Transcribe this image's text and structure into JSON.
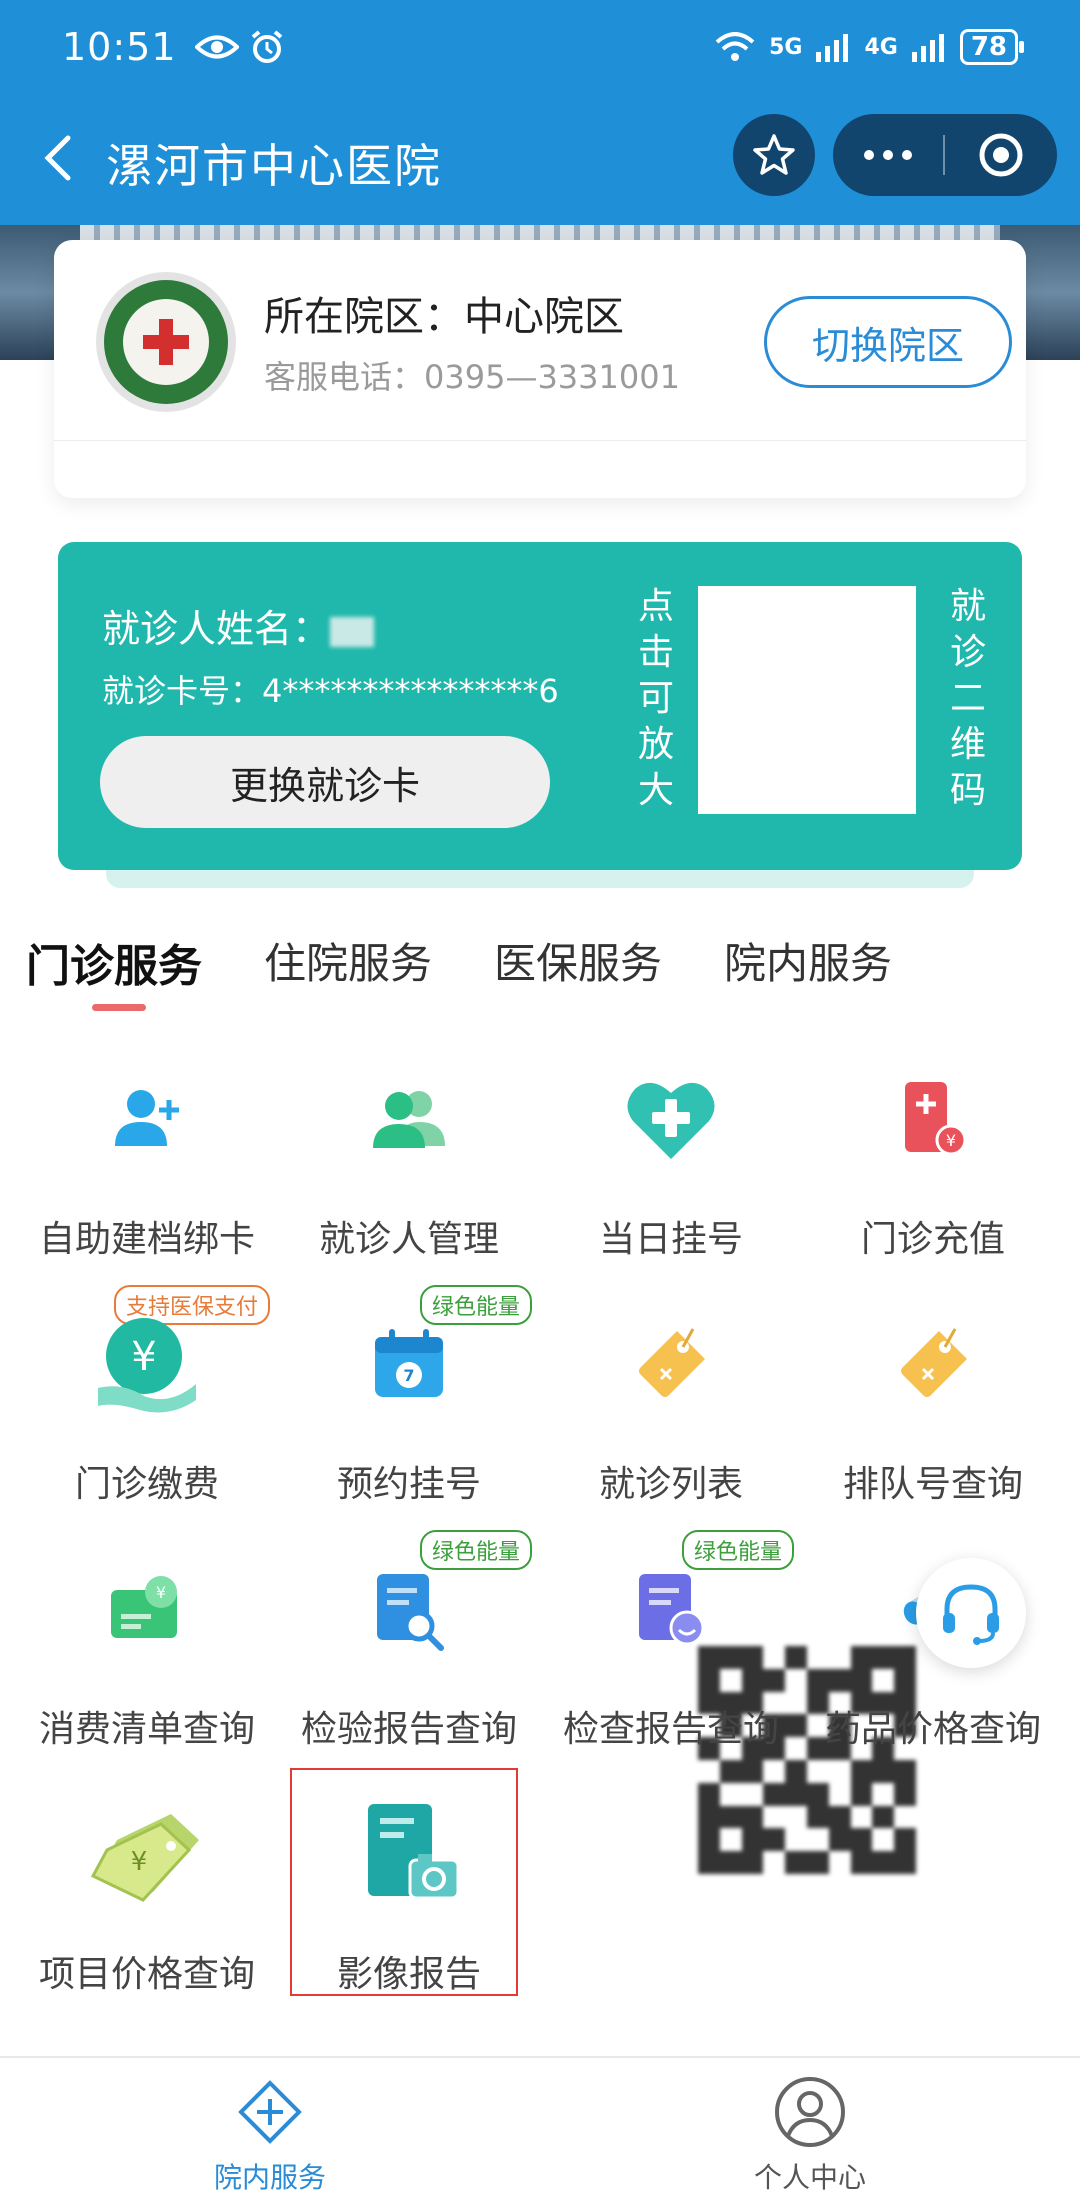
{
  "status_bar": {
    "time": "10:51",
    "net1": "5G",
    "net2": "4G",
    "battery": "78"
  },
  "header": {
    "title": "漯河市中心医院"
  },
  "hospital": {
    "campus": "所在院区：中心院区",
    "phone": "客服电话：0395—3331001",
    "switch_label": "切换院区"
  },
  "patient": {
    "name_label": "就诊人姓名：",
    "card_no": "就诊卡号：4****************6",
    "change_card_label": "更换就诊卡",
    "tap_hint": [
      "点",
      "击",
      "可",
      "放",
      "大"
    ],
    "qr_caption": [
      "就",
      "诊",
      "二",
      "维",
      "码"
    ]
  },
  "tabs": [
    {
      "label": "门诊服务"
    },
    {
      "label": "住院服务"
    },
    {
      "label": "医保服务"
    },
    {
      "label": "院内服务"
    }
  ],
  "services": [
    {
      "label": "自助建档绑卡",
      "icon": "add-user-icon"
    },
    {
      "label": "就诊人管理",
      "icon": "users-icon"
    },
    {
      "label": "当日挂号",
      "icon": "heart-plus-icon"
    },
    {
      "label": "门诊充值",
      "icon": "recharge-icon"
    },
    {
      "label": "门诊缴费",
      "icon": "yuan-hand-icon",
      "badge": "支持医保支付"
    },
    {
      "label": "预约挂号",
      "icon": "calendar-icon",
      "badge": "绿色能量"
    },
    {
      "label": "就诊列表",
      "icon": "tag-icon"
    },
    {
      "label": "排队号查询",
      "icon": "tag-icon"
    },
    {
      "label": "消费清单查询",
      "icon": "bill-icon"
    },
    {
      "label": "检验报告查询",
      "icon": "report-search-icon",
      "badge": "绿色能量"
    },
    {
      "label": "检查报告查询",
      "icon": "report-smile-icon",
      "badge": "绿色能量"
    },
    {
      "label": "药品价格查询",
      "icon": "pill-icon"
    },
    {
      "label": "项目价格查询",
      "icon": "price-tag-icon"
    },
    {
      "label": "影像报告",
      "icon": "image-report-icon"
    }
  ],
  "bottom_nav": [
    {
      "label": "院内服务",
      "active": true
    },
    {
      "label": "个人中心",
      "active": false
    }
  ],
  "colors": {
    "primary": "#1f8fd8",
    "teal": "#20b8ad",
    "accent_red": "#e53935"
  }
}
